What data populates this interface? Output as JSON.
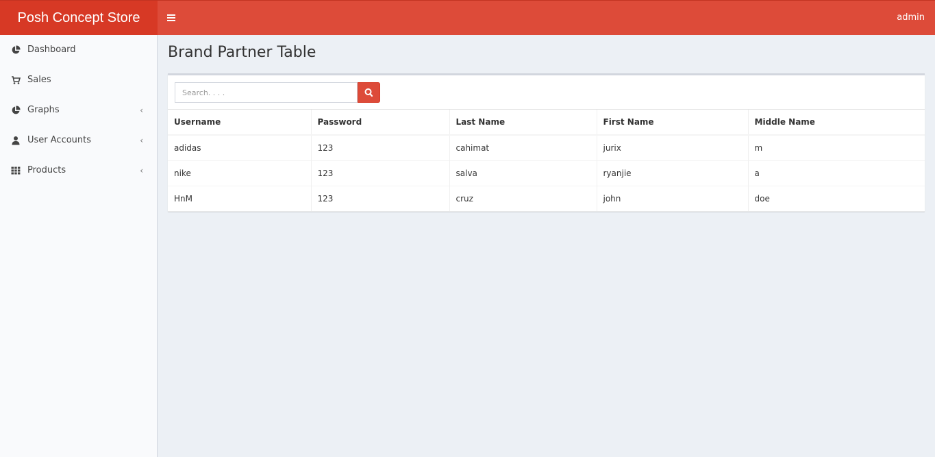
{
  "header": {
    "app_title": "Posh Concept Store",
    "user_label": "admin",
    "menu_icon": "hamburger-icon"
  },
  "sidebar": {
    "items": [
      {
        "label": "Dashboard",
        "icon": "pie-chart-icon",
        "has_submenu": false
      },
      {
        "label": "Sales",
        "icon": "cart-icon",
        "has_submenu": false
      },
      {
        "label": "Graphs",
        "icon": "pie-chart-icon",
        "has_submenu": true
      },
      {
        "label": "User Accounts",
        "icon": "user-icon",
        "has_submenu": true
      },
      {
        "label": "Products",
        "icon": "grid-icon",
        "has_submenu": true
      }
    ]
  },
  "main": {
    "page_title": "Brand Partner Table",
    "search": {
      "placeholder": "Search. . . .",
      "value": "",
      "button_icon": "search-icon"
    },
    "table": {
      "columns": [
        "Username",
        "Password",
        "Last Name",
        "First Name",
        "Middle Name"
      ],
      "rows": [
        [
          "adidas",
          "123",
          "cahimat",
          "jurix",
          "m"
        ],
        [
          "nike",
          "123",
          "salva",
          "ryanjie",
          "a"
        ],
        [
          "HnM",
          "123",
          "cruz",
          "john",
          "doe"
        ]
      ]
    }
  },
  "colors": {
    "accent": "#dd4b39",
    "background": "#ecf0f5",
    "sidebar": "#f9fafc"
  }
}
